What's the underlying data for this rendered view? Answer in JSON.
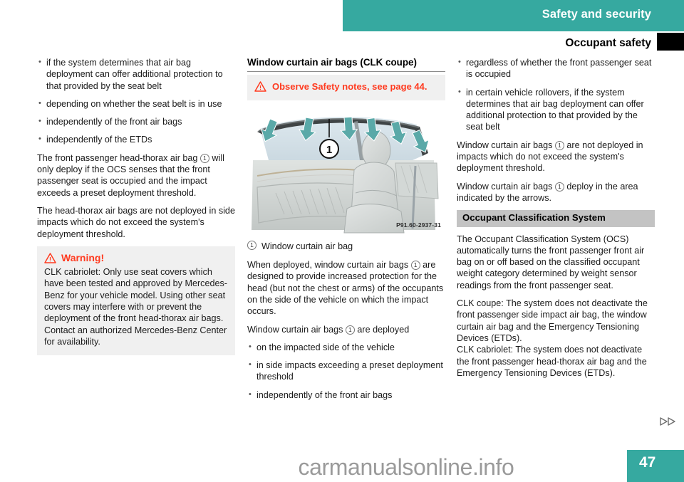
{
  "header": {
    "band_title": "Safety and security",
    "subtitle": "Occupant safety"
  },
  "left_column": {
    "bullets_top": [
      "if the system determines that air bag deployment can offer additional protection to that provided by the seat belt",
      "depending on whether the seat belt is in use",
      "independently of the front air bags",
      "independently of the ETDs"
    ],
    "para_1_before": "The front passenger head-thorax air bag ",
    "para_1_marker": "1",
    "para_1_after": " will only deploy if the OCS senses that the front passenger seat is occupied and the impact exceeds a preset deployment threshold.",
    "para_2": "The head-thorax air bags are not deployed in side impacts which do not exceed the system's deployment threshold.",
    "warning": {
      "icon": "warning-triangle-icon",
      "title": "Warning!",
      "body": "CLK cabriolet: Only use seat covers which have been tested and approved by Mercedes-Benz for your vehicle model. Using other seat covers may interfere with or prevent the deployment of the front head-thorax air bags. Contact an authorized Mercedes-Benz Center for availability."
    }
  },
  "middle_column": {
    "section_heading": "Window curtain air bags (CLK coupe)",
    "safety_note": {
      "icon": "warning-triangle-icon",
      "text": "Observe Safety notes, see page 44."
    },
    "figure": {
      "code": "P91.60-2937-31",
      "callout_marker": "1",
      "alt": "car-interior-window-curtain-airbag-illustration"
    },
    "caption_marker": "1",
    "caption_text": "Window curtain air bag",
    "para_1_before": "When deployed, window curtain air bags ",
    "para_1_marker": "1",
    "para_1_after": " are designed to provide increased protection for the head (but not the chest or arms) of the occupants on the side of the vehicle on which the impact occurs.",
    "para_2_before": "Window curtain air bags ",
    "para_2_marker": "1",
    "para_2_after": " are deployed",
    "bullets": [
      "on the impacted side of the vehicle",
      "in side impacts exceeding a preset deployment threshold",
      "independently of the front air bags"
    ]
  },
  "right_column": {
    "bullets_top": [
      "regardless of whether the front passenger seat is occupied",
      "in certain vehicle rollovers, if the system determines that air bag deployment can offer additional protection to that provided by the seat belt"
    ],
    "para_1_before": "Window curtain air bags ",
    "para_1_marker": "1",
    "para_1_after": " are not deployed in impacts which do not exceed the system's deployment threshold.",
    "para_2_before": "Window curtain air bags ",
    "para_2_marker": "1",
    "para_2_after": " deploy in the area indicated by the arrows.",
    "gray_heading": "Occupant Classification System",
    "para_3": "The Occupant Classification System (OCS) automatically turns the front passenger front air bag on or off based on the classified occupant weight category determined by weight sensor readings from the front passenger seat.",
    "para_4": "CLK coupe: The system does not deactivate the front passenger side impact air bag, the window curtain air bag and the Emergency Tensioning Devices (ETDs).",
    "para_5": "CLK cabriolet: The system does not deactivate the front passenger head-thorax air bag and the Emergency Tensioning Devices (ETDs)."
  },
  "footer": {
    "continuation_marker": "continue-arrows-icon",
    "page_number": "47",
    "watermark": "carmanualsonline.info"
  },
  "colors": {
    "teal": "#36a9a0",
    "warning_red": "#ff3b20",
    "gray_box": "#f0f0f0",
    "gray_heading": "#c3c3c3",
    "arrow_teal": "#5aa9a8"
  }
}
